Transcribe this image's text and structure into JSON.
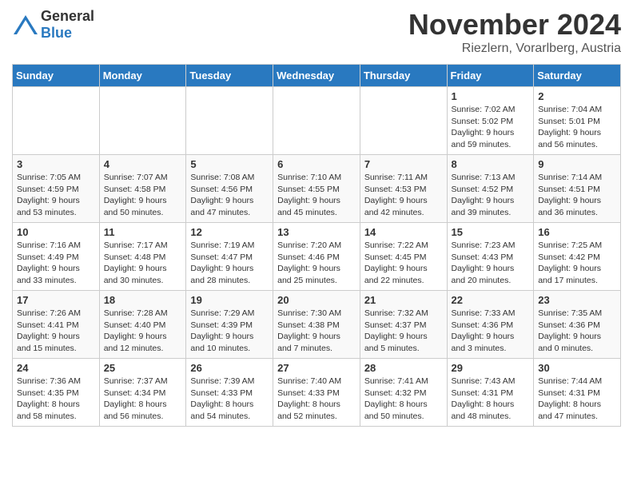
{
  "header": {
    "logo_general": "General",
    "logo_blue": "Blue",
    "month_title": "November 2024",
    "location": "Riezlern, Vorarlberg, Austria"
  },
  "calendar": {
    "days_of_week": [
      "Sunday",
      "Monday",
      "Tuesday",
      "Wednesday",
      "Thursday",
      "Friday",
      "Saturday"
    ],
    "weeks": [
      {
        "days": [
          {
            "num": "",
            "info": ""
          },
          {
            "num": "",
            "info": ""
          },
          {
            "num": "",
            "info": ""
          },
          {
            "num": "",
            "info": ""
          },
          {
            "num": "",
            "info": ""
          },
          {
            "num": "1",
            "info": "Sunrise: 7:02 AM\nSunset: 5:02 PM\nDaylight: 9 hours and 59 minutes."
          },
          {
            "num": "2",
            "info": "Sunrise: 7:04 AM\nSunset: 5:01 PM\nDaylight: 9 hours and 56 minutes."
          }
        ]
      },
      {
        "days": [
          {
            "num": "3",
            "info": "Sunrise: 7:05 AM\nSunset: 4:59 PM\nDaylight: 9 hours and 53 minutes."
          },
          {
            "num": "4",
            "info": "Sunrise: 7:07 AM\nSunset: 4:58 PM\nDaylight: 9 hours and 50 minutes."
          },
          {
            "num": "5",
            "info": "Sunrise: 7:08 AM\nSunset: 4:56 PM\nDaylight: 9 hours and 47 minutes."
          },
          {
            "num": "6",
            "info": "Sunrise: 7:10 AM\nSunset: 4:55 PM\nDaylight: 9 hours and 45 minutes."
          },
          {
            "num": "7",
            "info": "Sunrise: 7:11 AM\nSunset: 4:53 PM\nDaylight: 9 hours and 42 minutes."
          },
          {
            "num": "8",
            "info": "Sunrise: 7:13 AM\nSunset: 4:52 PM\nDaylight: 9 hours and 39 minutes."
          },
          {
            "num": "9",
            "info": "Sunrise: 7:14 AM\nSunset: 4:51 PM\nDaylight: 9 hours and 36 minutes."
          }
        ]
      },
      {
        "days": [
          {
            "num": "10",
            "info": "Sunrise: 7:16 AM\nSunset: 4:49 PM\nDaylight: 9 hours and 33 minutes."
          },
          {
            "num": "11",
            "info": "Sunrise: 7:17 AM\nSunset: 4:48 PM\nDaylight: 9 hours and 30 minutes."
          },
          {
            "num": "12",
            "info": "Sunrise: 7:19 AM\nSunset: 4:47 PM\nDaylight: 9 hours and 28 minutes."
          },
          {
            "num": "13",
            "info": "Sunrise: 7:20 AM\nSunset: 4:46 PM\nDaylight: 9 hours and 25 minutes."
          },
          {
            "num": "14",
            "info": "Sunrise: 7:22 AM\nSunset: 4:45 PM\nDaylight: 9 hours and 22 minutes."
          },
          {
            "num": "15",
            "info": "Sunrise: 7:23 AM\nSunset: 4:43 PM\nDaylight: 9 hours and 20 minutes."
          },
          {
            "num": "16",
            "info": "Sunrise: 7:25 AM\nSunset: 4:42 PM\nDaylight: 9 hours and 17 minutes."
          }
        ]
      },
      {
        "days": [
          {
            "num": "17",
            "info": "Sunrise: 7:26 AM\nSunset: 4:41 PM\nDaylight: 9 hours and 15 minutes."
          },
          {
            "num": "18",
            "info": "Sunrise: 7:28 AM\nSunset: 4:40 PM\nDaylight: 9 hours and 12 minutes."
          },
          {
            "num": "19",
            "info": "Sunrise: 7:29 AM\nSunset: 4:39 PM\nDaylight: 9 hours and 10 minutes."
          },
          {
            "num": "20",
            "info": "Sunrise: 7:30 AM\nSunset: 4:38 PM\nDaylight: 9 hours and 7 minutes."
          },
          {
            "num": "21",
            "info": "Sunrise: 7:32 AM\nSunset: 4:37 PM\nDaylight: 9 hours and 5 minutes."
          },
          {
            "num": "22",
            "info": "Sunrise: 7:33 AM\nSunset: 4:36 PM\nDaylight: 9 hours and 3 minutes."
          },
          {
            "num": "23",
            "info": "Sunrise: 7:35 AM\nSunset: 4:36 PM\nDaylight: 9 hours and 0 minutes."
          }
        ]
      },
      {
        "days": [
          {
            "num": "24",
            "info": "Sunrise: 7:36 AM\nSunset: 4:35 PM\nDaylight: 8 hours and 58 minutes."
          },
          {
            "num": "25",
            "info": "Sunrise: 7:37 AM\nSunset: 4:34 PM\nDaylight: 8 hours and 56 minutes."
          },
          {
            "num": "26",
            "info": "Sunrise: 7:39 AM\nSunset: 4:33 PM\nDaylight: 8 hours and 54 minutes."
          },
          {
            "num": "27",
            "info": "Sunrise: 7:40 AM\nSunset: 4:33 PM\nDaylight: 8 hours and 52 minutes."
          },
          {
            "num": "28",
            "info": "Sunrise: 7:41 AM\nSunset: 4:32 PM\nDaylight: 8 hours and 50 minutes."
          },
          {
            "num": "29",
            "info": "Sunrise: 7:43 AM\nSunset: 4:31 PM\nDaylight: 8 hours and 48 minutes."
          },
          {
            "num": "30",
            "info": "Sunrise: 7:44 AM\nSunset: 4:31 PM\nDaylight: 8 hours and 47 minutes."
          }
        ]
      }
    ]
  }
}
